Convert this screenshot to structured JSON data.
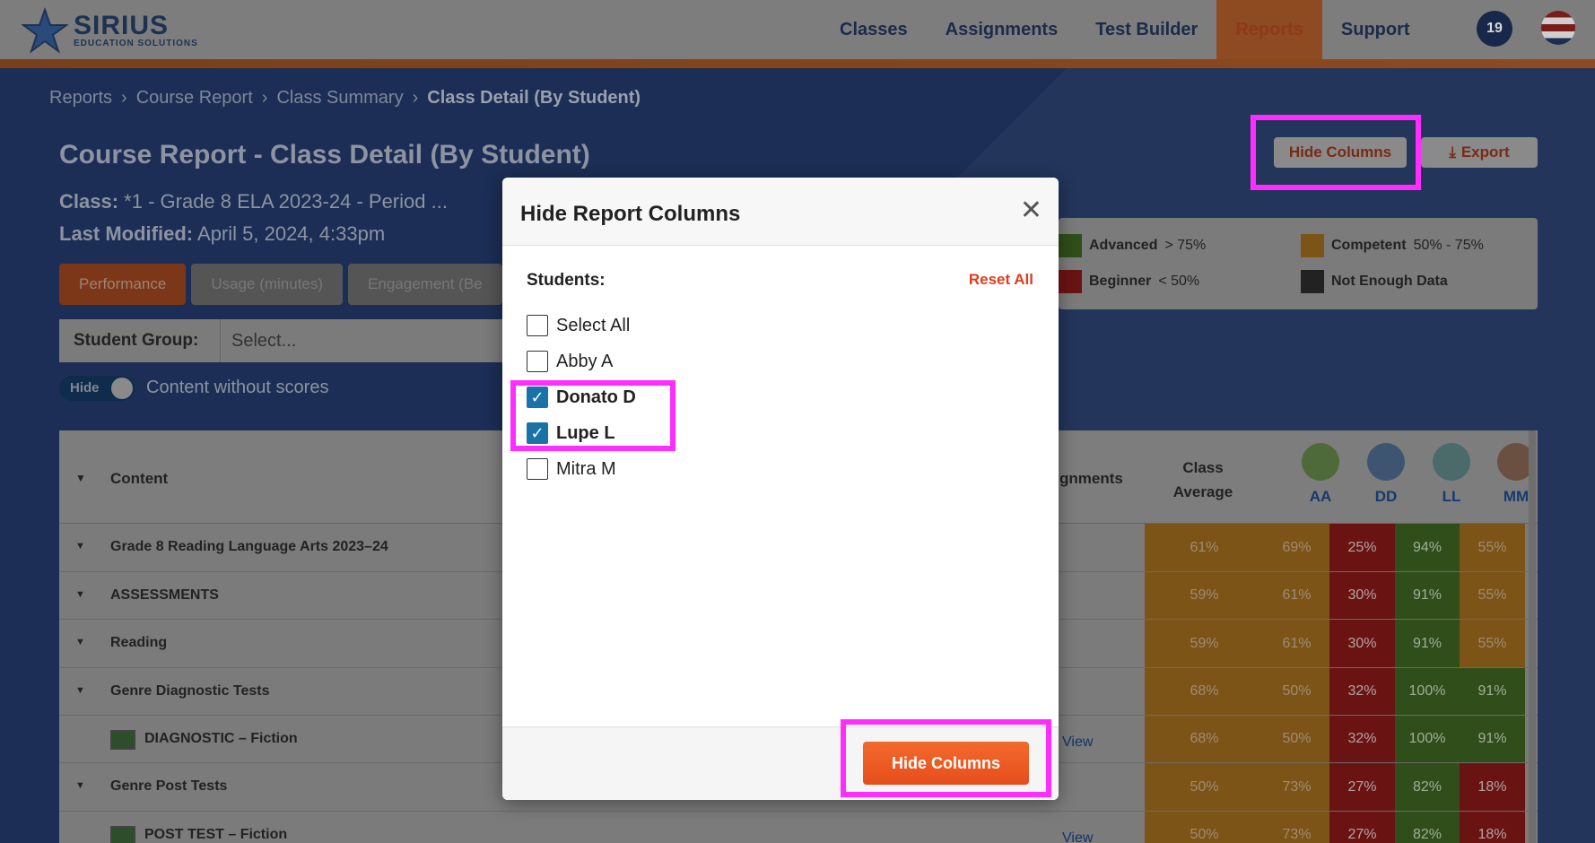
{
  "brand": {
    "name": "SIRIUS",
    "tagline": "EDUCATION SOLUTIONS"
  },
  "nav": [
    {
      "label": "Classes",
      "active": false
    },
    {
      "label": "Assignments",
      "active": false
    },
    {
      "label": "Test Builder",
      "active": false
    },
    {
      "label": "Reports",
      "active": true
    },
    {
      "label": "Support",
      "active": false
    }
  ],
  "notifications": "19",
  "breadcrumb": [
    "Reports",
    "Course Report",
    "Class Summary",
    "Class Detail (By Student)"
  ],
  "page": {
    "title": "Course Report - Class Detail (By Student)",
    "class_label": "Class:",
    "class_value": "*1 - Grade 8 ELA 2023-24 - Period ...",
    "modified_label": "Last Modified:",
    "modified_value": "April 5, 2024, 4:33pm"
  },
  "actions": {
    "hide_columns": "Hide Columns",
    "export": "Export"
  },
  "tabs": [
    "Performance",
    "Usage (minutes)",
    "Engagement (Be"
  ],
  "student_group": {
    "label": "Student Group:",
    "placeholder": "Select..."
  },
  "toggle": {
    "state": "Hide",
    "label": "Content without scores"
  },
  "legend": [
    {
      "name": "Advanced",
      "range": "> 75%",
      "color": "#2f4e1a"
    },
    {
      "name": "Competent",
      "range": "50% - 75%",
      "color": "#7d5418"
    },
    {
      "name": "Beginner",
      "range": "< 50%",
      "color": "#6a1313"
    },
    {
      "name": "Not Enough Data",
      "range": "",
      "color": "#222222"
    }
  ],
  "table": {
    "col_content": "Content",
    "col_assignments": "gnments",
    "col_avg": [
      "Class",
      "Average"
    ],
    "students": [
      "AA",
      "DD",
      "LL",
      "MM"
    ],
    "rows": [
      {
        "name": "Grade 8 Reading Language Arts 2023–24",
        "caret": true,
        "thumb": false,
        "view": "",
        "avg": "61%",
        "vals": [
          "69%",
          "25%",
          "94%",
          "55%"
        ]
      },
      {
        "name": "ASSESSMENTS",
        "caret": true,
        "thumb": false,
        "view": "",
        "avg": "59%",
        "vals": [
          "61%",
          "30%",
          "91%",
          "55%"
        ]
      },
      {
        "name": "Reading",
        "caret": true,
        "thumb": false,
        "view": "",
        "avg": "59%",
        "vals": [
          "61%",
          "30%",
          "91%",
          "55%"
        ]
      },
      {
        "name": "Genre Diagnostic Tests",
        "caret": true,
        "thumb": false,
        "view": "",
        "avg": "68%",
        "vals": [
          "50%",
          "32%",
          "100%",
          "91%"
        ]
      },
      {
        "name": "DIAGNOSTIC – Fiction",
        "caret": false,
        "thumb": true,
        "view": "View",
        "avg": "68%",
        "vals": [
          "50%",
          "32%",
          "100%",
          "91%"
        ]
      },
      {
        "name": "Genre Post Tests",
        "caret": true,
        "thumb": false,
        "view": "",
        "avg": "50%",
        "vals": [
          "73%",
          "27%",
          "82%",
          "18%"
        ]
      },
      {
        "name": "POST TEST – Fiction",
        "caret": false,
        "thumb": true,
        "view": "View",
        "avg": "50%",
        "vals": [
          "73%",
          "27%",
          "82%",
          "18%"
        ]
      }
    ]
  },
  "modal": {
    "title": "Hide Report Columns",
    "section": "Students:",
    "reset": "Reset All",
    "options": [
      {
        "label": "Select All",
        "checked": false
      },
      {
        "label": "Abby A",
        "checked": false
      },
      {
        "label": "Donato D",
        "checked": true
      },
      {
        "label": "Lupe L",
        "checked": true
      },
      {
        "label": "Mitra M",
        "checked": false
      }
    ],
    "submit": "Hide Columns"
  }
}
